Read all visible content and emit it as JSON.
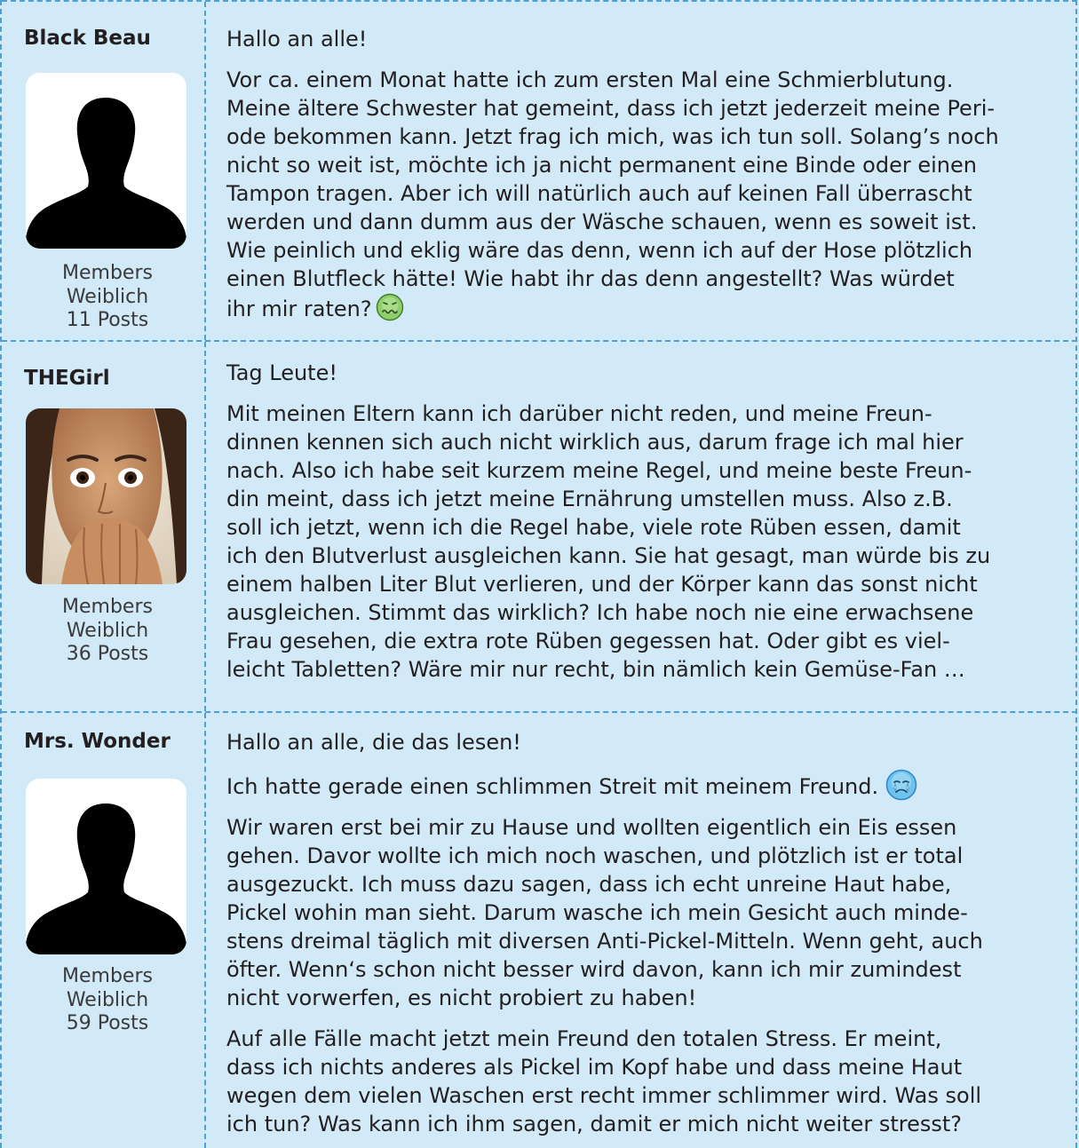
{
  "posts": [
    {
      "author": "Black Beau",
      "avatar": "silhouette-avatar",
      "rank": "Members",
      "gender": "Weiblich",
      "posts": "11 Posts",
      "greeting": "Hallo an alle!",
      "body": "Vor ca. einem Monat hatte ich zum ersten Mal eine Schmierblutung.\nMeine ältere Schwester hat gemeint, dass ich jetzt jederzeit meine Peri-\node bekommen kann. Jetzt frag ich mich, was ich tun soll. Solang’s noch\nnicht so weit ist, möchte ich ja nicht permanent eine Binde oder einen\nTampon tragen. Aber ich will natürlich auch auf keinen Fall überrascht\nwerden und dann dumm aus der Wäsche schauen, wenn es soweit ist.\nWie peinlich und eklig wäre das denn, wenn ich auf der Hose plötzlich\neinen Blutfleck hätte! Wie habt ihr das denn angestellt? Was würdet\nihr mir raten?",
      "emoji": "sick-face-icon"
    },
    {
      "author": "THEGirl",
      "avatar": "surprised-woman-photo",
      "rank": "Members",
      "gender": "Weiblich",
      "posts": "36 Posts",
      "greeting": "Tag Leute!",
      "body": "Mit meinen Eltern kann ich darüber nicht reden, und meine Freun-\ndinnen kennen sich auch nicht wirklich aus, darum frage ich mal hier\nnach. Also ich habe seit kurzem meine Regel, und meine beste Freun-\ndin meint, dass ich jetzt meine Ernährung umstellen muss. Also z.B.\nsoll ich jetzt, wenn ich die Regel habe, viele rote Rüben essen, damit\nich den Blutverlust ausgleichen kann. Sie hat gesagt, man würde bis zu\neinem halben Liter Blut verlieren, und der Körper kann das sonst nicht\nausgleichen. Stimmt das wirklich? Ich habe noch nie eine erwachsene\nFrau gesehen, die extra rote Rüben gegessen hat. Oder gibt es viel-\nleicht Tabletten? Wäre mir nur recht, bin nämlich kein Gemüse-Fan …"
    },
    {
      "author": "Mrs. Wonder",
      "avatar": "silhouette-avatar",
      "rank": "Members",
      "gender": "Weiblich",
      "posts": "59 Posts",
      "greeting": "Hallo an alle, die das lesen!",
      "line2": "Ich hatte gerade einen schlimmen Streit mit meinem Freund.",
      "emoji": "crying-face-icon",
      "body": "Wir waren erst bei mir zu Hause und wollten eigentlich ein Eis essen\ngehen. Davor wollte ich mich noch waschen, und plötzlich ist er total\nausgezuckt. Ich muss dazu sagen, dass ich echt unreine Haut habe,\nPickel wohin man sieht. Darum wasche ich mein Gesicht auch minde-\nstens dreimal täglich mit diversen Anti-Pickel-Mitteln. Wenn geht, auch\nöfter. Wenn‘s schon nicht besser wird davon, kann ich mir zumindest\nnicht vorwerfen, es nicht probiert zu haben!",
      "body2": "Auf alle Fälle macht jetzt mein Freund den totalen Stress. Er meint,\ndass ich nichts anderes als Pickel im Kopf habe und dass meine Haut\nwegen dem vielen Waschen erst recht immer schlimmer wird. Was soll\nich tun? Was kann ich ihm sagen, damit er mich nicht weiter stresst?"
    }
  ],
  "colors": {
    "background": "#d2e9f7",
    "divider": "#4d9fd6",
    "text": "#231f20"
  }
}
